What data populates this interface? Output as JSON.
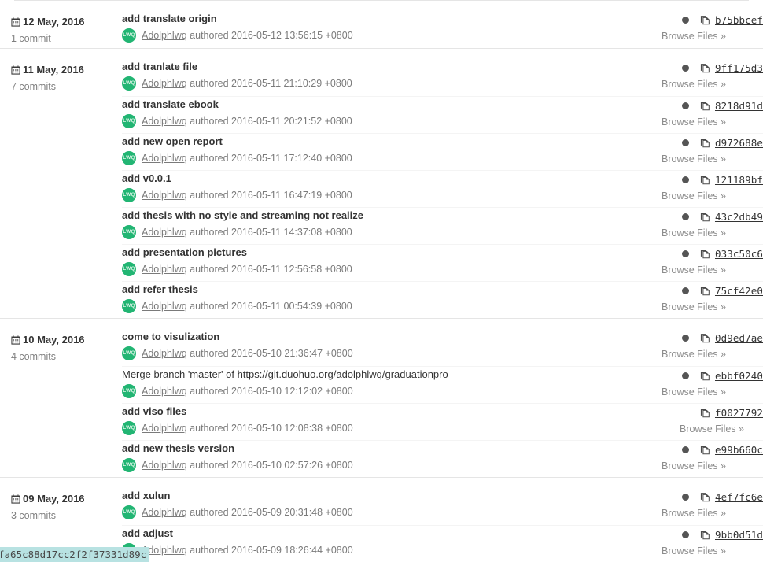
{
  "meta": {
    "author_name": "Adolphlwq",
    "authored_word": "authored",
    "avatar_initials": "LWQ",
    "browse_label": "Browse Files »",
    "accent_green": "#22b573",
    "dot_color": "#555555",
    "link_color": "#8c8c8c",
    "selection_bg": "#b8e2e2"
  },
  "selection": {
    "text": "fa65c88d17cc2f2f37331d89c"
  },
  "groups": [
    {
      "date": "12 May, 2016",
      "count_label": "1 commit",
      "commits": [
        {
          "title": "add translate origin",
          "timestamp": "2016-05-12 13:56:15 +0800",
          "sha": "b75bbcef",
          "has_dot": true,
          "merge": false,
          "hovered": false
        }
      ]
    },
    {
      "date": "11 May, 2016",
      "count_label": "7 commits",
      "commits": [
        {
          "title": "add tranlate file",
          "timestamp": "2016-05-11 21:10:29 +0800",
          "sha": "9ff175d3",
          "has_dot": true,
          "merge": false,
          "hovered": false
        },
        {
          "title": "add translate ebook",
          "timestamp": "2016-05-11 20:21:52 +0800",
          "sha": "8218d91d",
          "has_dot": true,
          "merge": false,
          "hovered": false
        },
        {
          "title": "add new open report",
          "timestamp": "2016-05-11 17:12:40 +0800",
          "sha": "d972688e",
          "has_dot": true,
          "merge": false,
          "hovered": false
        },
        {
          "title": "add v0.0.1",
          "timestamp": "2016-05-11 16:47:19 +0800",
          "sha": "121189bf",
          "has_dot": true,
          "merge": false,
          "hovered": false
        },
        {
          "title": "add thesis with no style and streaming not realize",
          "timestamp": "2016-05-11 14:37:08 +0800",
          "sha": "43c2db49",
          "has_dot": true,
          "merge": false,
          "hovered": true
        },
        {
          "title": "add presentation pictures",
          "timestamp": "2016-05-11 12:56:58 +0800",
          "sha": "033c50c6",
          "has_dot": true,
          "merge": false,
          "hovered": false
        },
        {
          "title": "add refer thesis",
          "timestamp": "2016-05-11 00:54:39 +0800",
          "sha": "75cf42e0",
          "has_dot": true,
          "merge": false,
          "hovered": false
        }
      ]
    },
    {
      "date": "10 May, 2016",
      "count_label": "4 commits",
      "commits": [
        {
          "title": "come to visulization",
          "timestamp": "2016-05-10 21:36:47 +0800",
          "sha": "0d9ed7ae",
          "has_dot": true,
          "merge": false,
          "hovered": false
        },
        {
          "title": "Merge branch 'master' of https://git.duohuo.org/adolphlwq/graduationpro",
          "timestamp": "2016-05-10 12:12:02 +0800",
          "sha": "ebbf0240",
          "has_dot": true,
          "merge": true,
          "hovered": false
        },
        {
          "title": "add viso files",
          "timestamp": "2016-05-10 12:08:38 +0800",
          "sha": "f0027792",
          "has_dot": false,
          "merge": false,
          "hovered": false
        },
        {
          "title": "add new thesis version",
          "timestamp": "2016-05-10 02:57:26 +0800",
          "sha": "e99b660c",
          "has_dot": true,
          "merge": false,
          "hovered": false
        }
      ]
    },
    {
      "date": "09 May, 2016",
      "count_label": "3 commits",
      "commits": [
        {
          "title": "add xulun",
          "timestamp": "2016-05-09 20:31:48 +0800",
          "sha": "4ef7fc6e",
          "has_dot": true,
          "merge": false,
          "hovered": false
        },
        {
          "title": "add adjust",
          "timestamp": "2016-05-09 18:26:44 +0800",
          "sha": "9bb0d51d",
          "has_dot": true,
          "merge": false,
          "hovered": false
        }
      ]
    }
  ]
}
